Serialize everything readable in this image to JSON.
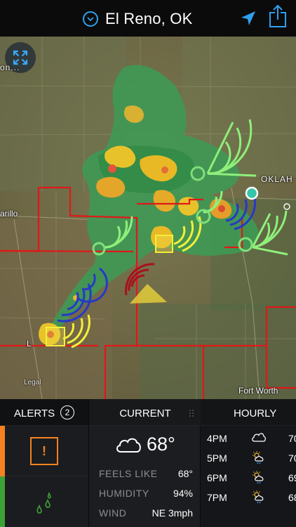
{
  "header": {
    "location": "El Reno, OK",
    "chevron_icon": "chevron-down-circle-icon",
    "nav_icon": "location-arrow-icon",
    "share_icon": "share-icon",
    "accent": "#2fa0f0"
  },
  "map": {
    "expand_icon": "expand-arrows-icon",
    "labels": {
      "top_left_fragment": "on...",
      "oklahoma": "OKLAH",
      "amarillo": "arillo",
      "fort_worth": "Fort Worth",
      "legal": "Legal",
      "small_l": "L"
    }
  },
  "alerts": {
    "title": "ALERTS",
    "count": "2",
    "items": [
      {
        "icon": "warning-exclamation-icon",
        "glyph": "!",
        "color": "#f58220"
      },
      {
        "icon": "rain-drops-icon",
        "color": "#3da236"
      }
    ]
  },
  "current": {
    "title": "CURRENT",
    "condition_icon": "cloud-icon",
    "temperature": "68°",
    "feels_like_label": "FEELS LIKE",
    "feels_like_value": "68°",
    "humidity_label": "HUMIDITY",
    "humidity_value": "94%",
    "wind_label": "WIND",
    "wind_value": "NE 3mph"
  },
  "hourly": {
    "title": "HOURLY",
    "rows": [
      {
        "time": "4PM",
        "icon": "cloud-icon",
        "temp": "70"
      },
      {
        "time": "5PM",
        "icon": "sun-cloud-rain-icon",
        "temp": "70"
      },
      {
        "time": "6PM",
        "icon": "sun-cloud-rain-icon",
        "temp": "69"
      },
      {
        "time": "7PM",
        "icon": "sun-cloud-rain-icon",
        "temp": "68"
      }
    ]
  }
}
